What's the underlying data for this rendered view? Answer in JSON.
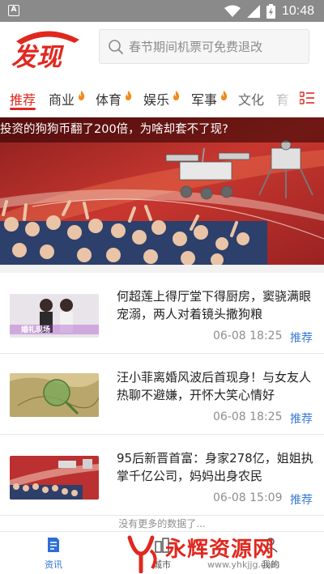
{
  "status_bar": {
    "time": "10:48",
    "notification_glyph": "A",
    "icons": [
      "wifi-icon",
      "signal-icon",
      "battery-icon"
    ]
  },
  "header": {
    "logo_text": "发现",
    "search": {
      "placeholder": "春节期间机票可免费退改"
    }
  },
  "tabs": [
    {
      "label": "推荐",
      "active": true,
      "hot": false
    },
    {
      "label": "商业",
      "active": false,
      "hot": true
    },
    {
      "label": "体育",
      "active": false,
      "hot": true
    },
    {
      "label": "娱乐",
      "active": false,
      "hot": true
    },
    {
      "label": "军事",
      "active": false,
      "hot": true
    },
    {
      "label": "文化",
      "active": false,
      "hot": false
    },
    {
      "label": "育",
      "active": false,
      "hot": false
    }
  ],
  "banner": {
    "title": "投资的狗狗币翻了200倍，为啥却套不了现?"
  },
  "news": [
    {
      "title": "何超莲上得厅堂下得厨房，窦骁满眼宠溺，两人对着镜头撒狗粮",
      "time": "06-08 18:25",
      "tag": "推荐",
      "thumb_caption": "婚礼现场"
    },
    {
      "title": "汪小菲离婚风波后首现身！与女友人热聊不避嫌，开怀大笑心情好",
      "time": "06-08 18:25",
      "tag": "推荐"
    },
    {
      "title": "95后新晋首富：身家278亿，姐姐执掌千亿公司，妈妈出身农民",
      "time": "06-08 15:09",
      "tag": "推荐"
    }
  ],
  "list_footer": "没有更多的数据了...",
  "bottom_nav": [
    {
      "label": "资讯",
      "icon": "news-icon",
      "active": true
    },
    {
      "label": "城市",
      "icon": "city-icon",
      "active": false
    },
    {
      "label": "我的",
      "icon": "profile-icon",
      "active": false
    }
  ],
  "watermark": {
    "text": "永辉资源网",
    "url": "www.yhkjjg.com"
  },
  "colors": {
    "accent": "#e0281f",
    "link": "#3a7bd5",
    "status_bar": "#8a8a8a"
  }
}
